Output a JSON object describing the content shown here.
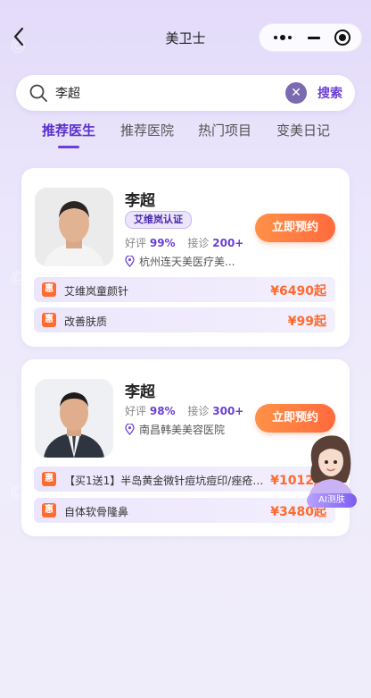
{
  "header": {
    "title": "美卫士"
  },
  "search": {
    "query": "李超",
    "submit_label": "搜索"
  },
  "tabs": [
    {
      "label": "推荐医生"
    },
    {
      "label": "推荐医院"
    },
    {
      "label": "热门项目"
    },
    {
      "label": "变美日记"
    }
  ],
  "doctors": [
    {
      "name": "李超",
      "certification": "艾维岚认证",
      "rating_label": "好评",
      "rating": "99%",
      "visits_label": "接诊",
      "visits": "200+",
      "hospital": "杭州连天美医疗美...",
      "book_label": "立即预约",
      "items": [
        {
          "badge": "惠",
          "name": "艾维岚童颜针",
          "price": "¥6490起"
        },
        {
          "badge": "惠",
          "name": "改善肤质",
          "price": "¥99起"
        }
      ]
    },
    {
      "name": "李超",
      "rating_label": "好评",
      "rating": "98%",
      "visits_label": "接诊",
      "visits": "300+",
      "hospital": "南昌韩美美容医院",
      "book_label": "立即预约",
      "items": [
        {
          "badge": "惠",
          "name": "【买1送1】半岛黄金微针痘坑痘印/痤疮/...",
          "price": "¥1012起"
        },
        {
          "badge": "惠",
          "name": "自体软骨隆鼻",
          "price": "¥3480起"
        }
      ]
    }
  ],
  "ai_assistant": {
    "label": "AI测肤"
  },
  "colors": {
    "accent": "#6a3fd8",
    "button": "#ff6a3d",
    "price": "#ff6a2e"
  }
}
